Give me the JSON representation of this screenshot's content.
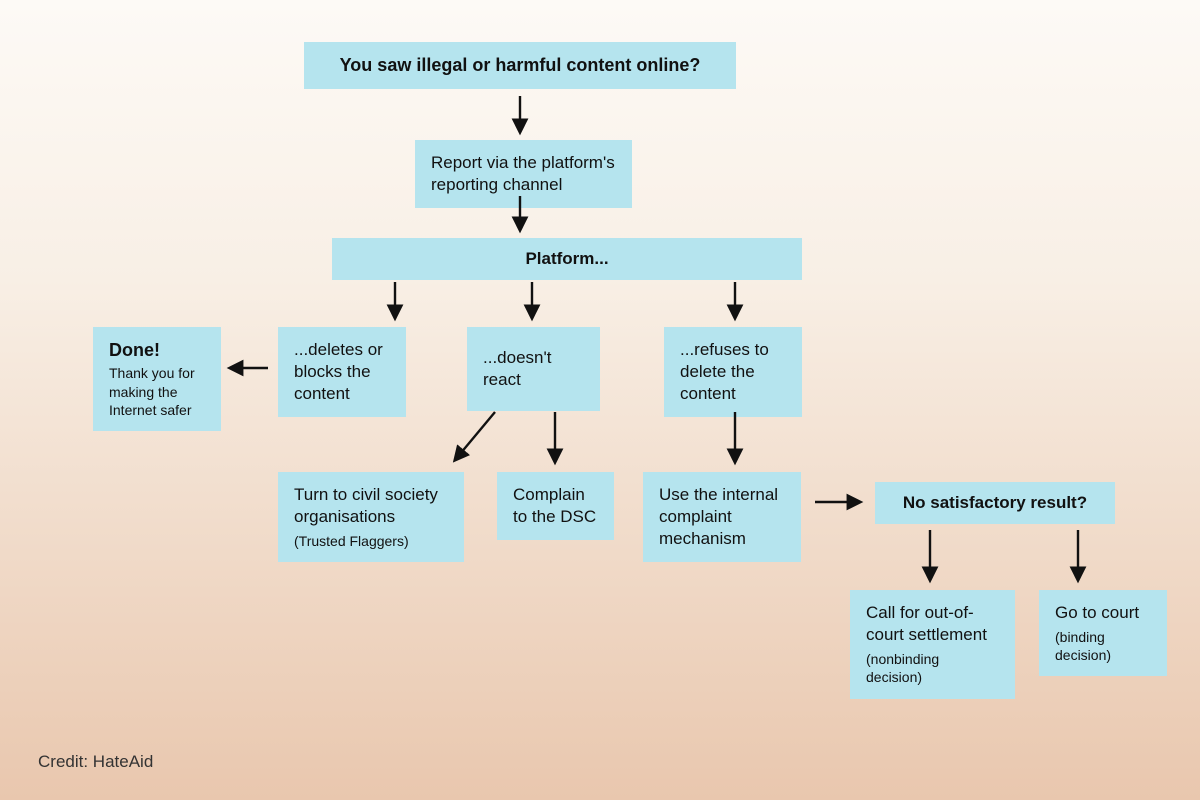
{
  "boxes": {
    "start": "You saw illegal or harmful content online?",
    "report": "Report via the platform's reporting channel",
    "platform": "Platform...",
    "done_bold": "Done!",
    "done_sub": "Thank you for making the Internet safer",
    "deletes": "...deletes or blocks the content",
    "noreact": "...doesn't react",
    "refuses": "...refuses to delete the content",
    "civil": "Turn to civil society organisations",
    "civil_sub": "(Trusted Flaggers)",
    "dsc": "Complain to the DSC",
    "internal": "Use the internal complaint mechanism",
    "nosat": "No satisfactory result?",
    "outcourt": "Call for out-of-court settlement",
    "outcourt_sub": "(nonbinding decision)",
    "gocourt": "Go to court",
    "gocourt_sub": "(binding decision)"
  },
  "credit": "Credit: HateAid"
}
